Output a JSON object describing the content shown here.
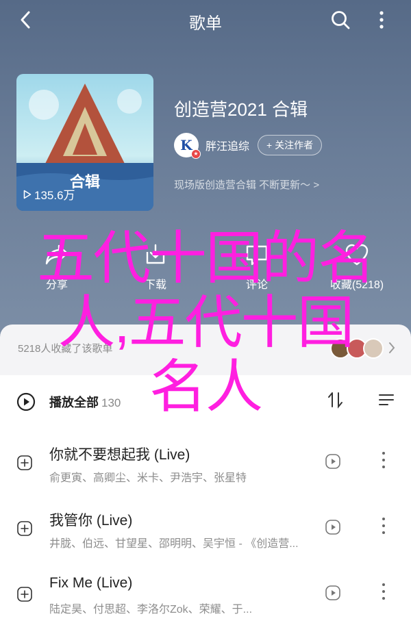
{
  "topbar": {
    "title": "歌单",
    "back_icon": "chevron-left-icon",
    "search_icon": "search-icon",
    "more_icon": "more-vertical-icon"
  },
  "album": {
    "cover_caption": "合辑",
    "play_count": "135.6万",
    "title": "创造营2021 合辑",
    "creator_name": "胖汪追综",
    "creator_avatar_letter": "K",
    "follow_label": "+ 关注作者",
    "description": "现场版创造营合辑 不断更新～ >"
  },
  "actions": [
    {
      "label": "分享",
      "icon": "share-icon"
    },
    {
      "label": "下载",
      "icon": "download-icon"
    },
    {
      "label": "评论",
      "icon": "comment-icon"
    },
    {
      "label": "收藏(5218)",
      "icon": "favorite-icon"
    }
  ],
  "collectors": {
    "text": "5218人收藏了该歌单",
    "avatar_colors": [
      "#7a5a3a",
      "#c85a5a",
      "#d9c9b9"
    ]
  },
  "list": {
    "play_all_label": "播放全部",
    "count": "130",
    "songs": [
      {
        "name": "你就不要想起我 (Live)",
        "artists": "俞更寅、高卿尘、米卡、尹浩宇、张星特"
      },
      {
        "name": "我管你 (Live)",
        "artists": "井胧、伯远、甘望星、邵明明、吴宇恒 - 《创造营..."
      },
      {
        "name": "Fix Me (Live)",
        "artists": "陆定昊、付思超、李洛尔Zok、荣耀、于..."
      }
    ]
  },
  "overlay": {
    "lines": [
      "五代十国的名",
      "人,五代十国",
      "名人"
    ]
  },
  "colors": {
    "hero": "#5b6d8a",
    "overlay": "#ff1fe0"
  }
}
